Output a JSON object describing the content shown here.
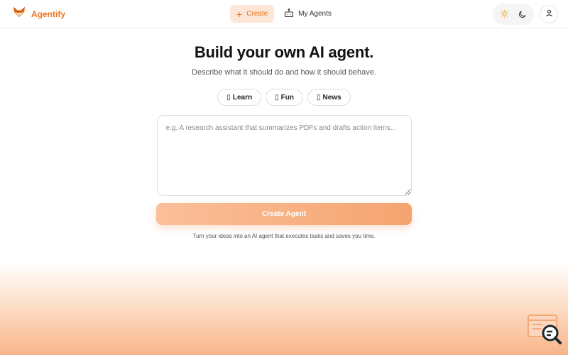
{
  "header": {
    "brand_name": "Agentify",
    "nav": {
      "create_label": "Create",
      "my_agents_label": "My Agents"
    }
  },
  "hero": {
    "title": "Build your own AI agent.",
    "subtitle": "Describe what it should do and how it should behave."
  },
  "chips": [
    {
      "glyph": "▯",
      "label": "Learn"
    },
    {
      "glyph": "▯",
      "label": "Fun"
    },
    {
      "glyph": "▯",
      "label": "News"
    }
  ],
  "prompt": {
    "value": "",
    "placeholder": "e.g. A research assistant that summarizes PDFs and drafts action items..."
  },
  "create_button_label": "Create Agent",
  "tagline": "Turn your ideas into an AI agent that executes tasks and saves you time.",
  "icons": {
    "logo": "fox-logo-icon",
    "create": "plus-icon",
    "my_agents": "robot-icon",
    "light_mode": "sun-icon",
    "dark_mode": "moon-icon",
    "profile": "user-icon",
    "corner": "search-document-icon"
  },
  "colors": {
    "accent": "#e8761f",
    "accent_light": "#fde6d6",
    "button_gradient_start": "#fbbf9a",
    "button_gradient_end": "#f5a46f",
    "bottom_glow": "#f8b58a"
  }
}
